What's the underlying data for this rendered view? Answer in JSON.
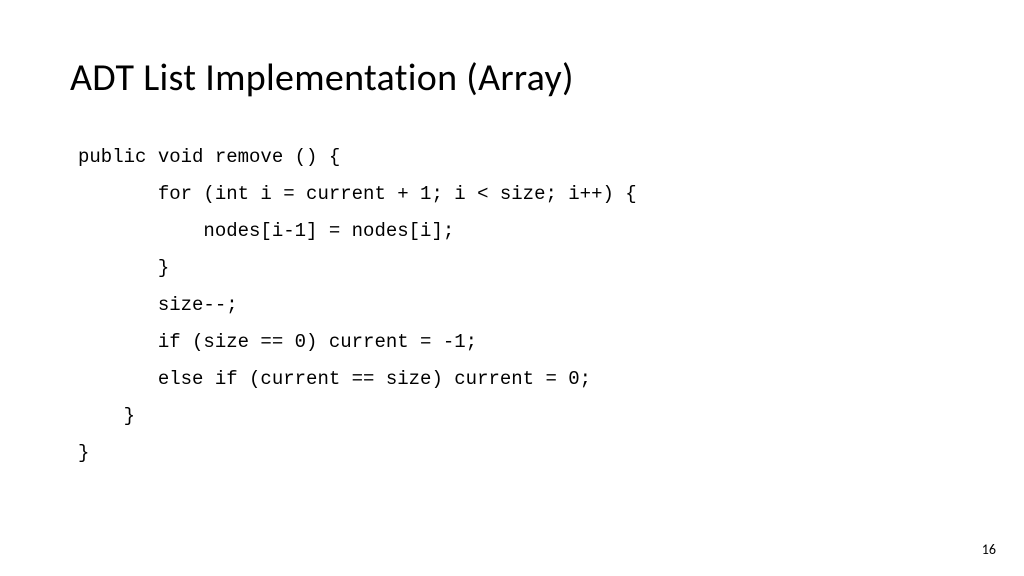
{
  "slide": {
    "title": "ADT List Implementation (Array)",
    "code_lines": {
      "l1": "public void remove () {",
      "l2": "       for (int i = current + 1; i < size; i++) {",
      "l3": "           nodes[i-1] = nodes[i];",
      "l4": "       }",
      "l5": "       size--;",
      "l6": "       if (size == 0) current = -1;",
      "l7": "       else if (current == size) current = 0;",
      "l8": "    }",
      "l9": "}"
    },
    "page_number": "16"
  }
}
